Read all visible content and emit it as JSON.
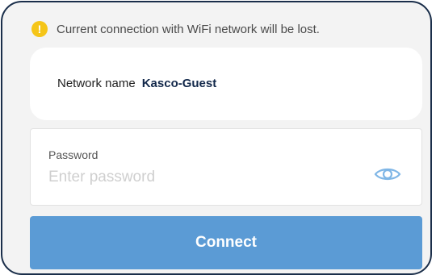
{
  "warning": {
    "icon": "exclamation-icon",
    "icon_glyph": "!",
    "text": "Current connection with WiFi network will be lost.",
    "icon_color": "#f5c518"
  },
  "network": {
    "label": "Network name",
    "value": "Kasco-Guest"
  },
  "password": {
    "label": "Password",
    "placeholder": "Enter password",
    "value": "",
    "toggle_icon": "eye-icon",
    "toggle_color": "#7fb6e6"
  },
  "connect": {
    "label": "Connect",
    "color": "#5b9bd5"
  }
}
